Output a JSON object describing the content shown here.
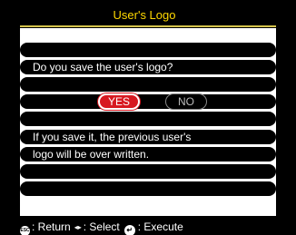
{
  "dialog": {
    "title": "User's Logo",
    "question": "Do you save the user's logo?",
    "yes_label": "YES",
    "no_label": "NO",
    "message_line1": "If you save it, the previous user's",
    "message_line2": "logo will be over written."
  },
  "footer": {
    "esc_icon": "ESC",
    "return_label": ": Return",
    "select_icon": "left-right-arrows",
    "select_label": ": Select",
    "execute_icon": "enter-icon",
    "execute_label": ": Execute"
  },
  "colors": {
    "title_text": "#ffd800",
    "title_underline": "#d5c44d",
    "yes_button": "#d71921",
    "background": "#000000",
    "panel": "#ffffff"
  }
}
